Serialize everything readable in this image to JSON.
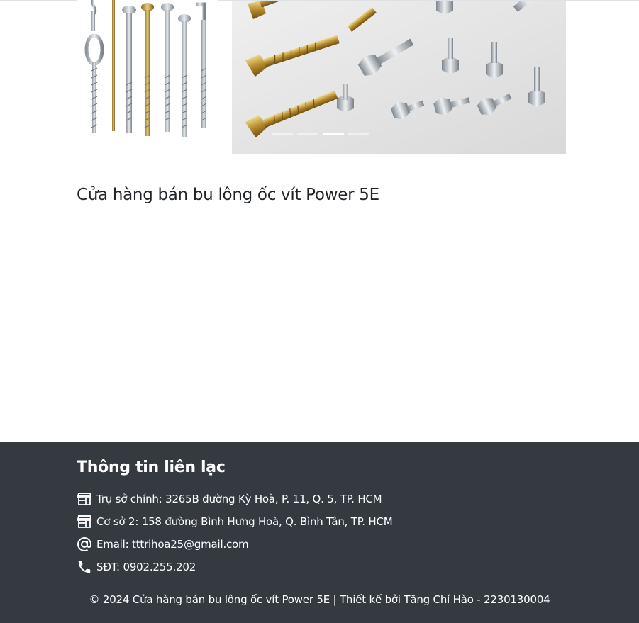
{
  "store": {
    "title": "Cửa hàng bán bu lông ốc vít Power 5E"
  },
  "carousel": {
    "slide_count": 4,
    "active_index": 2
  },
  "footer": {
    "heading": "Thông tin liên lạc",
    "contacts": [
      {
        "icon": "store-icon",
        "text": "Trụ sở chính: 3265B đường Kỳ Hoà, P. 11, Q. 5, TP. HCM"
      },
      {
        "icon": "store-icon",
        "text": "Cơ sở 2: 158 đường Bình Hưng Hoà, Q. Bình Tân, TP. HCM"
      },
      {
        "icon": "at-sign-icon",
        "text": "Email: tttrihoa25@gmail.com"
      },
      {
        "icon": "phone-icon",
        "text": "SĐT: 0902.255.202"
      }
    ],
    "copyright": "© 2024 Cửa hàng bán bu lông ốc vít Power 5E | Thiết kế bởi Tăng Chí Hào - 2230130004"
  },
  "colors": {
    "footer_bg": "#343a40",
    "text_dark": "#212529",
    "text_light": "#ffffff"
  }
}
